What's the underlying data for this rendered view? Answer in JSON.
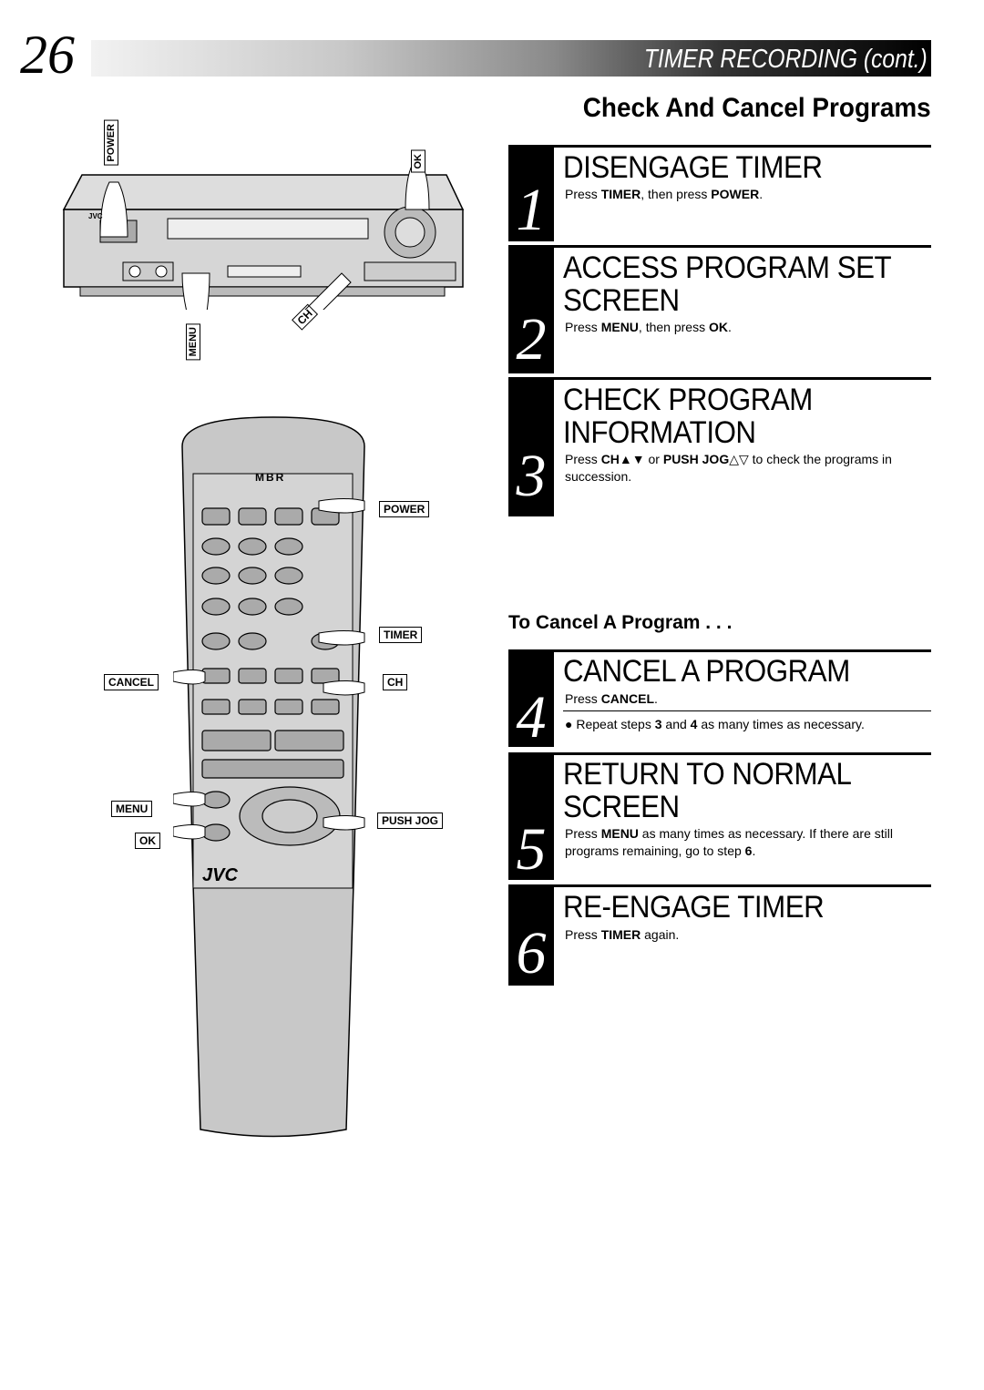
{
  "header": {
    "page_number": "26",
    "section": "TIMER RECORDING (cont.)"
  },
  "section_title": "Check And Cancel Programs",
  "steps": [
    {
      "number": "1",
      "title": "DISENGAGE TIMER",
      "text_html": "Press <b>TIMER</b>, then press <b>POWER</b>."
    },
    {
      "number": "2",
      "title": "ACCESS PROGRAM SET SCREEN",
      "text_html": "Press <b>MENU</b>, then press <b>OK</b>."
    },
    {
      "number": "3",
      "title": "CHECK PROGRAM INFORMATION",
      "text_html": "Press <b>CH▲▼</b> or <b>PUSH JOG</b>△▽ to check the programs in succession."
    },
    {
      "number": "4",
      "title": "CANCEL A PROGRAM",
      "text_html": "Press <b>CANCEL</b>.",
      "note_html": "● Repeat steps <b>3</b> and <b>4</b> as many times as necessary."
    },
    {
      "number": "5",
      "title": "RETURN TO NORMAL SCREEN",
      "text_html": "Press <b>MENU</b> as many times as necessary. If there are still programs remaining, go to step <b>6</b>."
    },
    {
      "number": "6",
      "title": "RE-ENGAGE TIMER",
      "text_html": "Press <b>TIMER</b> again."
    }
  ],
  "subheading": "To Cancel A Program . . .",
  "vcr_labels": {
    "power": "POWER",
    "ok": "OK",
    "menu": "MENU",
    "ch": "CH",
    "brand": "JVC"
  },
  "remote_labels": {
    "power": "POWER",
    "timer": "TIMER",
    "cancel": "CANCEL",
    "ch": "CH",
    "menu": "MENU",
    "push_jog": "PUSH JOG",
    "ok": "OK",
    "brand": "JVC",
    "logo": "MBR"
  }
}
